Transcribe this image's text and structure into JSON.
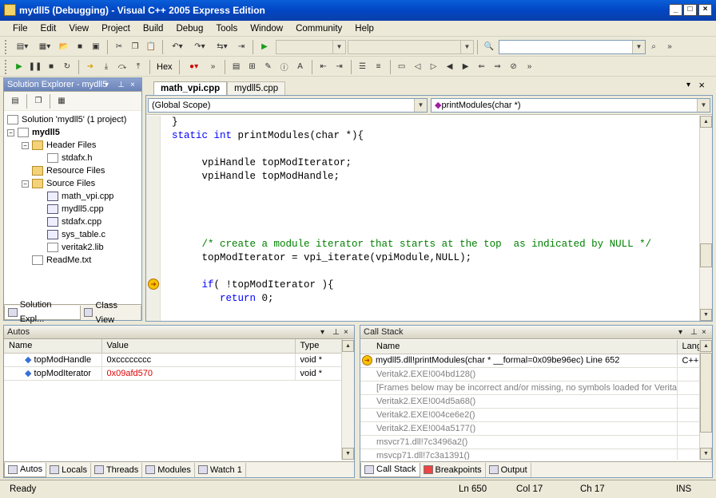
{
  "window": {
    "title": "mydll5 (Debugging) - Visual C++ 2005 Express Edition"
  },
  "menu": [
    "File",
    "Edit",
    "View",
    "Project",
    "Build",
    "Debug",
    "Tools",
    "Window",
    "Community",
    "Help"
  ],
  "debug_toolbar": {
    "hex_label": "Hex"
  },
  "solution_explorer": {
    "title": "Solution Explorer - mydll5",
    "solution": "Solution 'mydll5' (1 project)",
    "project": "mydll5",
    "header_files": "Header Files",
    "stdafx_h": "stdafx.h",
    "resource_files": "Resource Files",
    "source_files": "Source Files",
    "sources": [
      "math_vpi.cpp",
      "mydll5.cpp",
      "stdafx.cpp",
      "sys_table.c",
      "veritak2.lib"
    ],
    "readme": "ReadMe.txt",
    "tabs": [
      "Solution Expl...",
      "Class View"
    ]
  },
  "editor": {
    "tabs": [
      "math_vpi.cpp",
      "mydll5.cpp"
    ],
    "scope": "(Global Scope)",
    "function": "printModules(char *)",
    "lines": [
      {
        "indent": "",
        "text": "}",
        "type": "plain"
      },
      {
        "indent": "",
        "kw": "static int ",
        "text": "printModules(char *){",
        "type": "kwline"
      },
      {
        "indent": "",
        "text": "",
        "type": "plain"
      },
      {
        "indent": "     ",
        "text": "vpiHandle topModIterator;",
        "type": "plain"
      },
      {
        "indent": "     ",
        "text": "vpiHandle topModHandle;",
        "type": "plain"
      },
      {
        "indent": "",
        "text": "",
        "type": "plain"
      },
      {
        "indent": "",
        "text": "",
        "type": "plain"
      },
      {
        "indent": "",
        "text": "",
        "type": "plain"
      },
      {
        "indent": "",
        "text": "",
        "type": "plain"
      },
      {
        "indent": "     ",
        "text": "/* create a module iterator that starts at the top  as indicated by NULL */",
        "type": "comment"
      },
      {
        "indent": "     ",
        "text": "topModIterator = vpi_iterate(vpiModule,NULL);",
        "type": "plain"
      },
      {
        "indent": "",
        "text": "",
        "type": "plain"
      },
      {
        "indent": "     ",
        "kw": "if",
        "text": "( !topModIterator ){",
        "type": "kwline"
      },
      {
        "indent": "        ",
        "kw": "return ",
        "text": "0;",
        "type": "kwline"
      }
    ]
  },
  "autos": {
    "title": "Autos",
    "columns": [
      "Name",
      "Value",
      "Type"
    ],
    "rows": [
      {
        "name": "topModHandle",
        "value": "0xcccccccc",
        "type": "void *"
      },
      {
        "name": "topModIterator",
        "value": "0x09afd570",
        "type": "void *"
      }
    ],
    "changed_color": "#e00000",
    "tabs": [
      "Autos",
      "Locals",
      "Threads",
      "Modules",
      "Watch 1"
    ]
  },
  "callstack": {
    "title": "Call Stack",
    "columns": [
      "Name",
      "Langu"
    ],
    "rows": [
      {
        "name": "mydll5.dll!printModules(char * __formal=0x09be96ec)  Line 652",
        "lang": "C++"
      },
      {
        "name": "Veritak2.EXE!004bd128()",
        "lang": ""
      },
      {
        "name": "[Frames below may be incorrect and/or missing, no symbols loaded for Veritak",
        "lang": ""
      },
      {
        "name": "Veritak2.EXE!004d5a68()",
        "lang": ""
      },
      {
        "name": "Veritak2.EXE!004ce6e2()",
        "lang": ""
      },
      {
        "name": "Veritak2.EXE!004a5177()",
        "lang": ""
      },
      {
        "name": "msvcr71.dll!7c3496a2()",
        "lang": ""
      },
      {
        "name": "msvcp71.dll!7c3a1391()",
        "lang": ""
      }
    ],
    "tabs": [
      "Call Stack",
      "Breakpoints",
      "Output"
    ]
  },
  "status": {
    "ready": "Ready",
    "ln": "Ln 650",
    "col": "Col 17",
    "ch": "Ch 17",
    "mode": "INS"
  },
  "colors": {
    "keyword": "#0000ff",
    "comment": "#008000",
    "titlebar": "#0246c4"
  }
}
